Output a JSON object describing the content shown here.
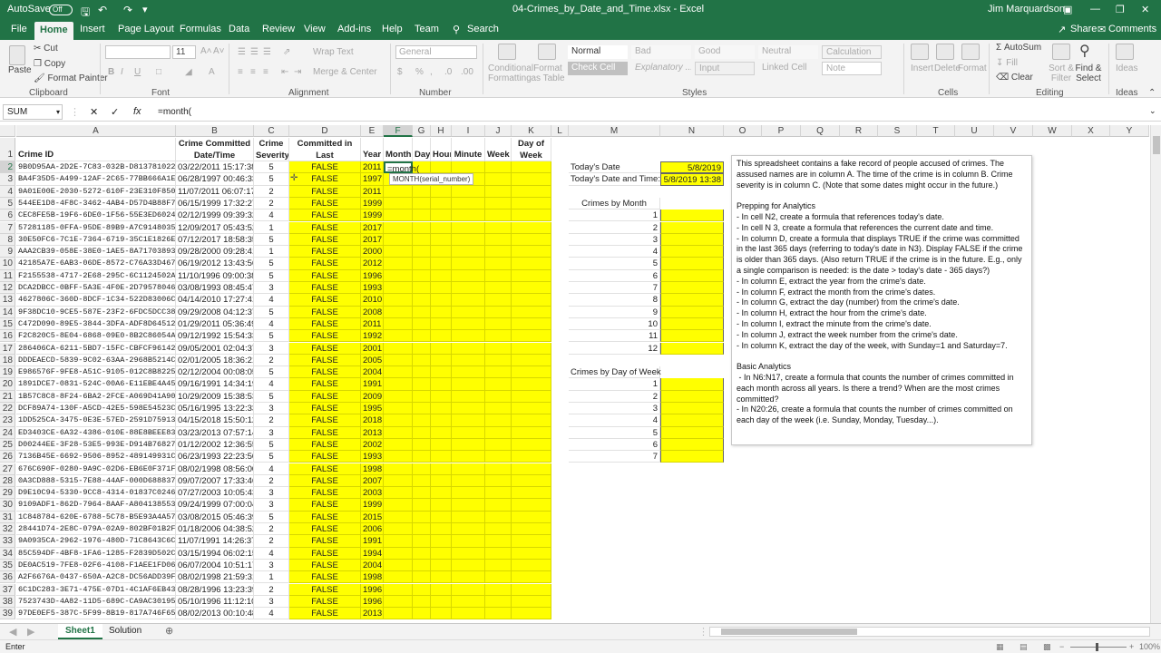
{
  "titlebar": {
    "autosave_label": "AutoSave",
    "autosave_state": "Off",
    "file_title": "04-Crimes_by_Date_and_Time.xlsx  -  Excel",
    "user_name": "Jim Marquardson"
  },
  "ribbon_tabs": [
    "File",
    "Home",
    "Insert",
    "Page Layout",
    "Formulas",
    "Data",
    "Review",
    "View",
    "Add-ins",
    "Help",
    "Team"
  ],
  "search_label": "Search",
  "share_label": "Share",
  "comments_label": "Comments",
  "ribbon": {
    "paste": "Paste",
    "cut": "Cut",
    "copy": "Copy",
    "format_painter": "Format Painter",
    "font_size": "11",
    "wrap_text": "Wrap Text",
    "merge_center": "Merge & Center",
    "number_format": "General",
    "conditional_formatting": "Conditional Formatting",
    "format_as_table": "Format as Table",
    "styles": [
      "Normal",
      "Bad",
      "Good",
      "Neutral",
      "Calculation",
      "Check Cell",
      "Explanatory ...",
      "Input",
      "Linked Cell",
      "Note"
    ],
    "insert": "Insert",
    "delete": "Delete",
    "format": "Format",
    "autosum": "AutoSum",
    "fill": "Fill",
    "clear": "Clear",
    "sort_filter": "Sort & Filter",
    "find_select": "Find & Select",
    "ideas": "Ideas",
    "groups": [
      "Clipboard",
      "Font",
      "Alignment",
      "Number",
      "Styles",
      "Cells",
      "Editing",
      "Ideas"
    ]
  },
  "formula_bar": {
    "name_box": "SUM",
    "formula": "=month("
  },
  "columns": [
    "A",
    "B",
    "C",
    "D",
    "E",
    "F",
    "G",
    "H",
    "I",
    "J",
    "K",
    "L",
    "M",
    "N",
    "O",
    "P",
    "Q",
    "R",
    "S",
    "T",
    "U",
    "V",
    "W",
    "X",
    "Y"
  ],
  "headers": {
    "A": "Crime ID",
    "B": [
      "Crime Committed",
      "Date/Time"
    ],
    "C": [
      "Crime",
      "Severity"
    ],
    "D": [
      "Committed in Last",
      "365 Days?"
    ],
    "E": "Year",
    "F": "Month",
    "G": "Day",
    "H": "Hour",
    "I": "Minute",
    "J": "Week",
    "K": [
      "Day of",
      "Week"
    ]
  },
  "active_cell_text": "=month(",
  "tooltip": "MONTH(serial_number)",
  "rows": [
    [
      "9B0D95AA-2D2E-7C83-032B-D81378102207",
      "03/22/2011 15:17:38",
      5,
      "FALSE",
      2011
    ],
    [
      "BA4F35D5-A499-12AF-2C65-77BB666A1E8E",
      "06/28/1997 00:46:33",
      5,
      "FALSE",
      1997
    ],
    [
      "9A01E00E-2030-5272-610F-23E310F85092",
      "11/07/2011 06:07:17",
      2,
      "FALSE",
      2011
    ],
    [
      "544EE1D8-4F8C-3462-4AB4-D57D4B88F723",
      "06/15/1999 17:32:27",
      2,
      "FALSE",
      1999
    ],
    [
      "CEC8FE5B-19F6-6DE0-1F56-55E3ED6024D3",
      "02/12/1999 09:39:32",
      4,
      "FALSE",
      1999
    ],
    [
      "57281185-0FFA-95DE-89B9-A7C9148035E8",
      "12/09/2017 05:43:52",
      1,
      "FALSE",
      2017
    ],
    [
      "30E50FC6-7C1E-7364-6719-35C1E1826E58",
      "07/12/2017 18:58:35",
      5,
      "FALSE",
      2017
    ],
    [
      "AAA2CB39-058E-38E0-1AE5-8A717038934F",
      "09/28/2000 09:28:41",
      1,
      "FALSE",
      2000
    ],
    [
      "42185A7E-6AB3-06DE-8572-C76A33D467FD",
      "06/19/2012 13:43:56",
      5,
      "FALSE",
      2012
    ],
    [
      "F2155538-4717-2E68-295C-6C1124502A44",
      "11/10/1996 09:00:38",
      5,
      "FALSE",
      1996
    ],
    [
      "DCA2DBCC-0BFF-5A3E-4F0E-2D79578046E8",
      "03/08/1993 08:45:47",
      3,
      "FALSE",
      1993
    ],
    [
      "4627806C-360D-8DCF-1C34-522D83006CC0",
      "04/14/2010 17:27:41",
      4,
      "FALSE",
      2010
    ],
    [
      "9F38DC10-9CE5-587E-23F2-6FDC5DCC38D5",
      "09/29/2008 04:12:37",
      5,
      "FALSE",
      2008
    ],
    [
      "C472D090-89E5-3844-3DFA-ADF8D645126E",
      "01/29/2011 05:36:49",
      4,
      "FALSE",
      2011
    ],
    [
      "F2C820C5-8E04-6868-09E0-8B2C86054A30",
      "09/12/1992 15:54:33",
      5,
      "FALSE",
      1992
    ],
    [
      "286406CA-6211-5BD7-15FC-CBFCF9614282",
      "09/05/2001 02:04:37",
      3,
      "FALSE",
      2001
    ],
    [
      "DDDEAECD-5839-9C02-63AA-2968B5214C8",
      "02/01/2005 18:36:21",
      2,
      "FALSE",
      2005
    ],
    [
      "E986576F-9FE8-A51C-9105-012C8B822582",
      "02/12/2004 00:08:05",
      5,
      "FALSE",
      2004
    ],
    [
      "1891DCE7-0831-524C-00A6-E11EBE4A454F",
      "09/16/1991 14:34:19",
      4,
      "FALSE",
      1991
    ],
    [
      "1B57C8C8-8F24-6BA2-2FCE-A069D41A90AC",
      "10/29/2009 15:38:53",
      5,
      "FALSE",
      2009
    ],
    [
      "DCF89A74-130F-A5CD-42E5-598E54523C1F",
      "05/16/1995 13:22:33",
      3,
      "FALSE",
      1995
    ],
    [
      "1DD525CA-3475-0E3E-57ED-2591D75913C",
      "04/15/2018 15:50:12",
      2,
      "FALSE",
      2018
    ],
    [
      "ED3403CE-6A32-4386-010E-88E8BEEE83BD",
      "03/23/2013 07:57:14",
      3,
      "FALSE",
      2013
    ],
    [
      "D00244EE-3F28-53E5-993E-D914B76827A8",
      "01/12/2002 12:36:55",
      5,
      "FALSE",
      2002
    ],
    [
      "7136B45E-6692-9506-8952-489149931CD1",
      "06/23/1993 22:23:50",
      5,
      "FALSE",
      1993
    ],
    [
      "676C690F-0280-9A9C-02D6-EB6E0F371F5C",
      "08/02/1998 08:56:00",
      4,
      "FALSE",
      1998
    ],
    [
      "0A3CD888-5315-7E88-44AF-000D68883767",
      "09/07/2007 17:33:46",
      2,
      "FALSE",
      2007
    ],
    [
      "D9E10C94-5330-9CC8-4314-01837C0246DE",
      "07/27/2003 10:05:43",
      3,
      "FALSE",
      2003
    ],
    [
      "9109ADF1-862D-7964-8AAF-A8041385534",
      "09/24/1999 07:00:04",
      3,
      "FALSE",
      1999
    ],
    [
      "1C848784-620E-6788-5C78-B5E93A4A5768",
      "03/08/2015 05:46:39",
      5,
      "FALSE",
      2015
    ],
    [
      "28441D74-2E8C-079A-02A9-802BF01B2F3E",
      "01/18/2006 04:38:52",
      2,
      "FALSE",
      2006
    ],
    [
      "9A0935CA-2962-1976-480D-71C8643C6CD7",
      "11/07/1991 14:26:37",
      2,
      "FALSE",
      1991
    ],
    [
      "85C594DF-4BF8-1FA6-1285-F2839D502C5A",
      "03/15/1994 06:02:15",
      4,
      "FALSE",
      1994
    ],
    [
      "DE0AC519-7FE8-02F6-4108-F1AEE1FD0695",
      "06/07/2004 10:51:17",
      3,
      "FALSE",
      2004
    ],
    [
      "A2F6676A-0437-650A-A2C8-DC56ADD39F27",
      "08/02/1998 21:59:31",
      1,
      "FALSE",
      1998
    ],
    [
      "6C1DC283-3E71-475E-07D1-4C1AF6EB4356",
      "08/28/1996 13:23:39",
      2,
      "FALSE",
      1996
    ],
    [
      "7523743D-4A82-11D5-689C-CA9AC301959A",
      "05/10/1996 11:12:10",
      3,
      "FALSE",
      1996
    ],
    [
      "97DE0EF5-387C-5F99-8B19-817A746F6502",
      "08/02/2013 00:10:48",
      4,
      "FALSE",
      2013
    ]
  ],
  "side": {
    "todays_date_label": "Today's Date",
    "todays_date": "5/8/2019",
    "todays_datetime_label": "Today's Date and Time:",
    "todays_datetime": "5/8/2019 13:38",
    "crimes_by_month_label": "Crimes by Month",
    "months": [
      1,
      2,
      3,
      4,
      5,
      6,
      7,
      8,
      9,
      10,
      11,
      12
    ],
    "crimes_by_dow_label": "Crimes by Day of Week",
    "days": [
      1,
      2,
      3,
      4,
      5,
      6,
      7
    ]
  },
  "note_text": "This spreadsheet contains a fake record of people accused of crimes. The assused names are in column A. The time of the crime is in column B. Crime severity is in column C. (Note that some dates might occur in the future.)\n\nPrepping for Analytics\n- In cell N2, create a formula that references today's date.\n- In cell N 3, create a formula that references the current date and time.\n- In column D, create a formula that displays TRUE if the crime was committed in the last 365 days (referring to today's date in N3). Display FALSE if the crime is older than 365 days. (Also return TRUE if the crime is in the future. E.g., only a single comparison is needed: is the date > today's date - 365 days?)\n- In column E, extract the year from the crime's date.\n- In column F, extract the month from the crime's dates.\n- In column G, extract the day (number) from the crime's date.\n- In column H, extract the hour from the crime's date.\n- In column I, extract the minute from the crime's date.\n- In column J, extract the week number from the crime's date.\n- In column K, extract the day of the week, with Sunday=1 and Saturday=7.\n\nBasic Analytics\n - In N6:N17, create a formula that counts the number of crimes committed in each month across all years. Is there a trend? When are the most crimes committed?\n- In N20:26, create a formula that counts the number of crimes committed on each day of the week (i.e. Sunday, Monday, Tuesday...).",
  "sheet_tabs": [
    "Sheet1",
    "Solution"
  ],
  "status_mode": "Enter",
  "zoom": "100%",
  "colors": {
    "excel_green": "#217346",
    "highlight_yellow": "#ffff00"
  }
}
